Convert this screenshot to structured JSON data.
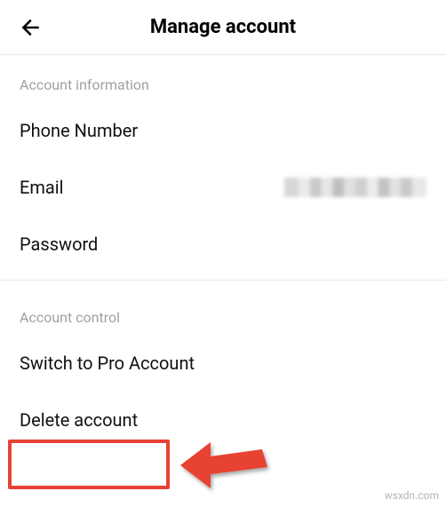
{
  "header": {
    "title": "Manage account"
  },
  "sections": {
    "info": {
      "header": "Account information",
      "rows": {
        "phone": {
          "label": "Phone Number"
        },
        "email": {
          "label": "Email"
        },
        "password": {
          "label": "Password"
        }
      }
    },
    "control": {
      "header": "Account control",
      "rows": {
        "pro": {
          "label": "Switch to Pro Account"
        },
        "delete": {
          "label": "Delete account"
        }
      }
    }
  },
  "watermark": "wsxdn.com",
  "colors": {
    "highlight": "#e74233"
  }
}
